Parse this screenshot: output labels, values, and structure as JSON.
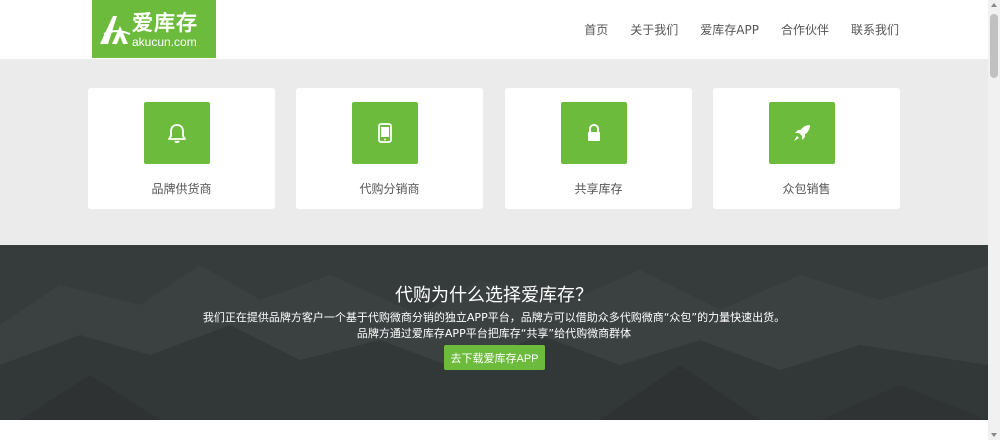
{
  "header": {
    "logo": {
      "name_cn": "爱库存",
      "domain": "akucun.com",
      "color": "#6dbb3c"
    },
    "nav": [
      "首页",
      "关于我们",
      "爱库存APP",
      "合作伙伴",
      "联系我们"
    ]
  },
  "features": {
    "cards": [
      {
        "label": "品牌供货商",
        "icon": "bell-icon"
      },
      {
        "label": "代购分销商",
        "icon": "tablet-icon"
      },
      {
        "label": "共享库存",
        "icon": "lock-icon"
      },
      {
        "label": "众包销售",
        "icon": "rocket-icon"
      }
    ]
  },
  "hero": {
    "title": "代购为什么选择爱库存？",
    "line1": "我们正在提供品牌方客户一个基于代购微商分销的独立APP平台，品牌方可以借助众多代购微商“众包”的力量快速出货。",
    "line2": "品牌方通过爱库存APP平台把库存“共享”给代购微商群体",
    "button": "去下载爱库存APP"
  },
  "colors": {
    "accent": "#6dbb3c",
    "band": "#ebebeb",
    "hero": "#3a3f3f"
  }
}
